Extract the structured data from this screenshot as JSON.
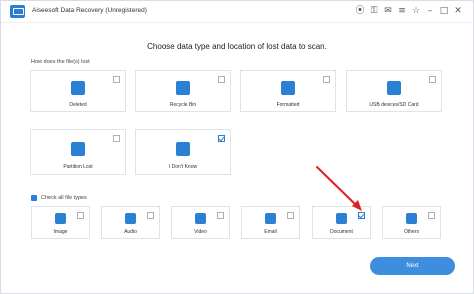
{
  "app": {
    "title": "Aiseesoft Data Recovery (Unregistered)"
  },
  "titlebar_icons": [
    {
      "name": "cart-icon",
      "glyph": "⦿"
    },
    {
      "name": "key-icon",
      "glyph": "⚿"
    },
    {
      "name": "chat-icon",
      "glyph": "✉"
    },
    {
      "name": "menu-icon",
      "glyph": "≡"
    },
    {
      "name": "pin-icon",
      "glyph": "☆"
    },
    {
      "name": "minimize-icon",
      "glyph": "–"
    },
    {
      "name": "maximize-icon",
      "glyph": "□"
    },
    {
      "name": "close-icon",
      "glyph": "✕"
    }
  ],
  "heading": "Choose data type and location of lost data to scan.",
  "section_label": "How does the file(s) lost",
  "loss_types": [
    {
      "label": "Deleted",
      "checked": false
    },
    {
      "label": "Recycle Bin",
      "checked": false
    },
    {
      "label": "Formatted",
      "checked": false
    },
    {
      "label": "USB devices/SD Card",
      "checked": false
    },
    {
      "label": "Partition Lost",
      "checked": false
    },
    {
      "label": "I Don't Know",
      "checked": true
    }
  ],
  "check_all": {
    "label": "Check all file types",
    "checked": true
  },
  "file_types": [
    {
      "label": "Image",
      "checked": false
    },
    {
      "label": "Audio",
      "checked": false
    },
    {
      "label": "Video",
      "checked": false
    },
    {
      "label": "Email",
      "checked": false
    },
    {
      "label": "Document",
      "checked": true
    },
    {
      "label": "Others",
      "checked": false
    }
  ],
  "next_button": {
    "label": "Next"
  },
  "colors": {
    "accent": "#2a80d2",
    "button": "#3e8ee0",
    "annotation_arrow": "#e02020"
  }
}
